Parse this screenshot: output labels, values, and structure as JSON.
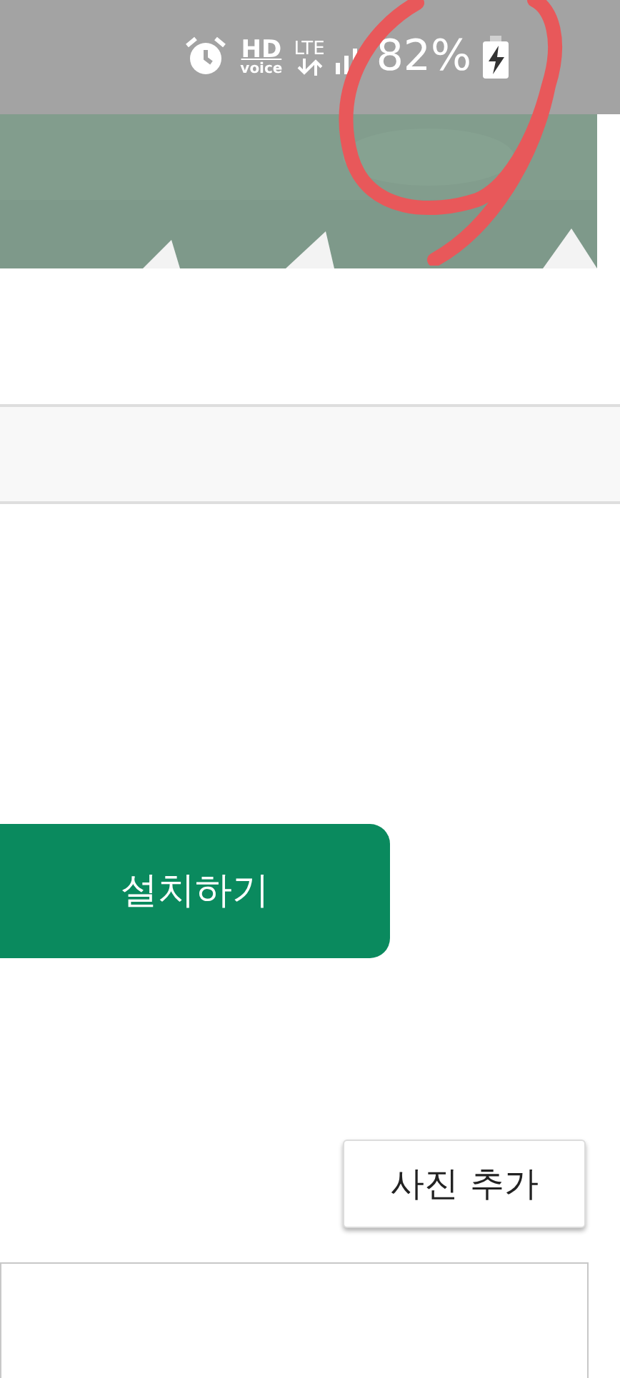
{
  "status_bar": {
    "hd": "HD",
    "voice": "voice",
    "lte": "LTE",
    "battery": "82%"
  },
  "install_button": {
    "label": "설치하기"
  },
  "add_photo_button": {
    "label": "사진 추가"
  }
}
